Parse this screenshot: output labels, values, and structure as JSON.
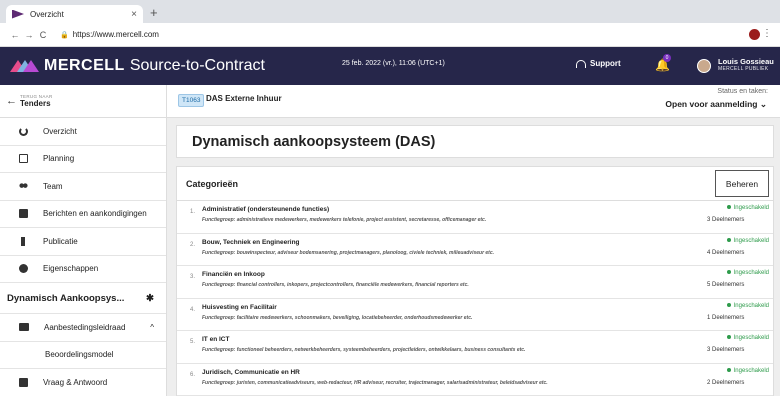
{
  "browser": {
    "tab_title": "Overzicht",
    "tab_close": "×",
    "new_tab": "+",
    "url": "https://www.mercell.com"
  },
  "header": {
    "brand": "MERCELL",
    "product": "Source-to-Contract",
    "datetime": "25 feb. 2022 (vr.), 11:06 (UTC+1)",
    "support": "Support",
    "notification_count": "0",
    "user_name": "Louis Gossieau",
    "user_org": "MERCELL PUBLIEK"
  },
  "sidebar": {
    "back_small": "TERUG NAAR",
    "back_title": "Tenders",
    "items": [
      {
        "label": "Overzicht",
        "icon": "dashboard-icon"
      },
      {
        "label": "Planning",
        "icon": "calendar-icon"
      },
      {
        "label": "Team",
        "icon": "people-icon"
      },
      {
        "label": "Berichten en aankondigingen",
        "icon": "chat-icon"
      },
      {
        "label": "Publicatie",
        "icon": "pin-icon"
      },
      {
        "label": "Eigenschappen",
        "icon": "gear-icon"
      }
    ],
    "section_title": "Dynamisch Aankoopsys...",
    "section_items": [
      {
        "label": "Aanbestedingsleidraad",
        "icon": "book-icon"
      }
    ],
    "sub_items": [
      {
        "label": "Beoordelingsmodel"
      }
    ],
    "last_item": {
      "label": "Vraag & Antwoord",
      "icon": "chat-icon"
    }
  },
  "tender": {
    "code": "T1063",
    "name": "DAS Externe Inhuur",
    "status_label": "Status en taken:",
    "status_value": "Open voor aanmelding"
  },
  "main": {
    "title": "Dynamisch aankoopsysteem (DAS)",
    "categories_title": "Categorieën",
    "manage_button": "Beheren",
    "categories": [
      {
        "num": "1.",
        "name": "Administratief (ondersteunende functies)",
        "desc": "Functiegroep: administratieve medewerkers, medewerkers telefonie, project assistent, secretaresse, officemanager etc.",
        "status": "Ingeschakeld",
        "count": "3 Deelnemers"
      },
      {
        "num": "2.",
        "name": "Bouw, Techniek en Engineering",
        "desc": "Functiegroep: bouwinspecteur, adviseur bodemsanering, projectmanagers, planoloog, civiele techniek, milieuadviseur etc.",
        "status": "Ingeschakeld",
        "count": "4 Deelnemers"
      },
      {
        "num": "3.",
        "name": "Financiën en Inkoop",
        "desc": "Functiegroep: financial controllers, inkopers, projectcontrollers, financiële medewerkers, financial reporters etc.",
        "status": "Ingeschakeld",
        "count": "5 Deelnemers"
      },
      {
        "num": "4.",
        "name": "Huisvesting en Facilitair",
        "desc": "Functiegroep: facilitaire medewerkers, schoonmakers, beveiliging, locatiebeheerder, onderhoudsmedewerker etc.",
        "status": "Ingeschakeld",
        "count": "1 Deelnemers"
      },
      {
        "num": "5.",
        "name": "IT en ICT",
        "desc": "Functiegroep: functioneel beheerders, netwerkbeheerders, systeembeheerders, projectleiders, ontwikkelaars, business consultants etc.",
        "status": "Ingeschakeld",
        "count": "3 Deelnemers"
      },
      {
        "num": "6.",
        "name": "Juridisch, Communicatie en HR",
        "desc": "Functiegroep: juristen, communicatieadviseurs, web-redacteur, HR adviseur, recruiter, trajectmanager, salarisadministrateur, beleidsadviseur etc.",
        "status": "Ingeschakeld",
        "count": "2 Deelnemers"
      }
    ]
  },
  "colors": {
    "header_bg": "#26264a",
    "status_green": "#2e9b4b",
    "tag_bg": "#cfe6f7"
  }
}
